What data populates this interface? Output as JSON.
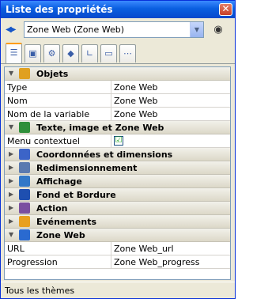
{
  "window": {
    "title": "Liste des propriétés"
  },
  "selector": {
    "value": "Zone Web (Zone Web)"
  },
  "tabs": [
    {
      "icon": "property-list-icon"
    },
    {
      "icon": "save-icon"
    },
    {
      "icon": "gear-icon"
    },
    {
      "icon": "shapes-icon"
    },
    {
      "icon": "chart-icon"
    },
    {
      "icon": "monitor-icon"
    },
    {
      "icon": "more-icon"
    }
  ],
  "groups": {
    "objets": {
      "label": "Objets",
      "props": [
        {
          "name": "Type",
          "value": "Zone Web"
        },
        {
          "name": "Nom",
          "value": "Zone Web"
        },
        {
          "name": "Nom de la variable",
          "value": "Zone Web"
        }
      ]
    },
    "texte": {
      "label": "Texte, image et Zone Web",
      "props": [
        {
          "name": "Menu contextuel",
          "value": "☑"
        }
      ]
    },
    "coord": {
      "label": "Coordonnées et dimensions"
    },
    "redim": {
      "label": "Redimensionnement"
    },
    "affichage": {
      "label": "Affichage"
    },
    "fond": {
      "label": "Fond et Bordure"
    },
    "action": {
      "label": "Action"
    },
    "evenements": {
      "label": "Evénements"
    },
    "zoneweb": {
      "label": "Zone Web",
      "props": [
        {
          "name": "URL",
          "value": "Zone Web_url"
        },
        {
          "name": "Progression",
          "value": "Zone Web_progress"
        }
      ]
    }
  },
  "status": {
    "text": "Tous les thèmes"
  },
  "colors": {
    "titlebar": "#0a5fe0",
    "group_bg": "#e6e3d6"
  }
}
